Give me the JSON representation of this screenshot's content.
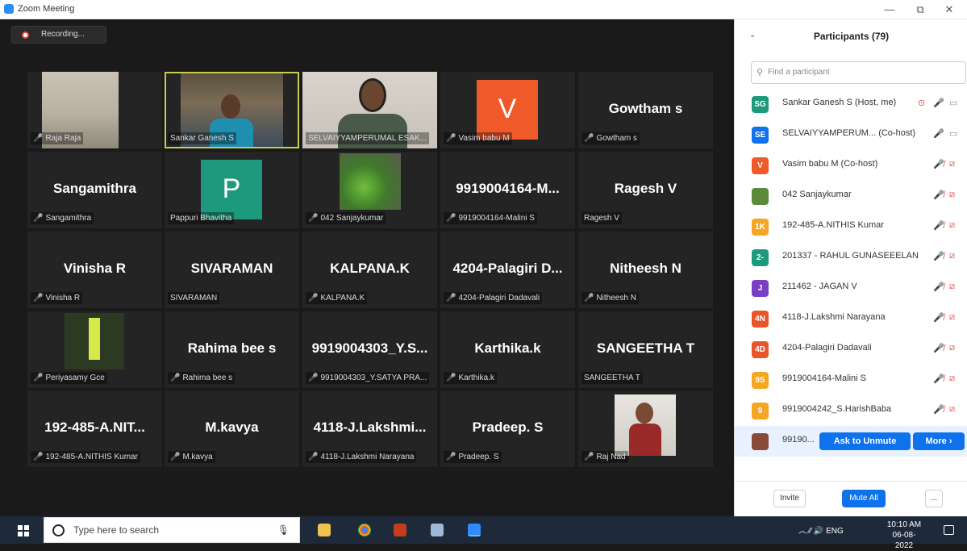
{
  "window": {
    "title": "Zoom Meeting",
    "minimize": "—",
    "restore": "⧉",
    "close": "✕"
  },
  "recording": {
    "label": "Recording..."
  },
  "tiles": [
    {
      "big": "",
      "label": "Raja Raja",
      "muted": true,
      "kind": "photo-room"
    },
    {
      "big": "",
      "label": "Sankar Ganesh S",
      "muted": false,
      "kind": "photo-person",
      "active": true
    },
    {
      "big": "",
      "label": "SELVAIYYAMPERUMAL ESAK...",
      "muted": false,
      "kind": "photo-person2"
    },
    {
      "big": "",
      "label": "Vasim babu M",
      "muted": true,
      "kind": "avatar",
      "avatar_letter": "V",
      "avatar_color": "#f0592a"
    },
    {
      "big": "Gowtham s",
      "label": "Gowtham s",
      "muted": true,
      "kind": "name"
    },
    {
      "big": "Sangamithra",
      "label": "Sangamithra",
      "muted": true,
      "kind": "name"
    },
    {
      "big": "",
      "label": "Pappuri Bhavitha",
      "muted": false,
      "kind": "avatar",
      "avatar_letter": "P",
      "avatar_color": "#1d9a7d"
    },
    {
      "big": "",
      "label": "042 Sanjaykumar",
      "muted": true,
      "kind": "photo-grass"
    },
    {
      "big": "9919004164-M...",
      "label": "9919004164-Malini S",
      "muted": true,
      "kind": "name"
    },
    {
      "big": "Ragesh V",
      "label": "Ragesh V",
      "muted": false,
      "kind": "name"
    },
    {
      "big": "Vinisha R",
      "label": "Vinisha R",
      "muted": true,
      "kind": "name"
    },
    {
      "big": "SIVARAMAN",
      "label": "SIVARAMAN",
      "muted": false,
      "kind": "name"
    },
    {
      "big": "KALPANA.K",
      "label": "KALPANA.K",
      "muted": true,
      "kind": "name"
    },
    {
      "big": "4204-Palagiri  D...",
      "label": "4204-Palagiri Dadavali",
      "muted": true,
      "kind": "name"
    },
    {
      "big": "Nitheesh N",
      "label": "Nitheesh N",
      "muted": true,
      "kind": "name"
    },
    {
      "big": "",
      "label": "Periyasamy Gce",
      "muted": true,
      "kind": "photo-board"
    },
    {
      "big": "Rahima bee s",
      "label": "Rahima bee s",
      "muted": true,
      "kind": "name"
    },
    {
      "big": "9919004303_Y.S...",
      "label": "9919004303_Y.SATYA PRA...",
      "muted": true,
      "kind": "name"
    },
    {
      "big": "Karthika.k",
      "label": "Karthika.k",
      "muted": true,
      "kind": "name"
    },
    {
      "big": "SANGEETHA  T",
      "label": "SANGEETHA  T",
      "muted": false,
      "kind": "name"
    },
    {
      "big": "192-485-A.NIT...",
      "label": "192-485-A.NITHIS Kumar",
      "muted": true,
      "kind": "name"
    },
    {
      "big": "M.kavya",
      "label": "M.kavya",
      "muted": true,
      "kind": "name"
    },
    {
      "big": "4118-J.Lakshmi...",
      "label": "4118-J.Lakshmi Narayana",
      "muted": true,
      "kind": "name"
    },
    {
      "big": "Pradeep. S",
      "label": "Pradeep. S",
      "muted": true,
      "kind": "name"
    },
    {
      "big": "",
      "label": "Raj Nad",
      "muted": true,
      "kind": "photo-kid"
    }
  ],
  "panel": {
    "title": "Participants (79)",
    "search_placeholder": "Find a participant",
    "participants": [
      {
        "initials": "SG",
        "color": "#1d9a7d",
        "name": "Sankar Ganesh S (Host, me)",
        "mic_muted": false,
        "video_off": false,
        "share": true
      },
      {
        "initials": "SE",
        "color": "#0e72ed",
        "name": "SELVAIYYAMPERUM...  (Co-host)",
        "mic_muted": false,
        "video_off": false,
        "share": false
      },
      {
        "initials": "V",
        "color": "#f0592a",
        "name": "Vasim babu M (Co-host)",
        "mic_muted": true,
        "video_off": true,
        "share": false
      },
      {
        "initials": "",
        "color": "#5a8a3a",
        "name": "042 Sanjaykumar",
        "mic_muted": true,
        "video_off": true,
        "share": false
      },
      {
        "initials": "1K",
        "color": "#f5a623",
        "name": "192-485-A.NITHIS Kumar",
        "mic_muted": true,
        "video_off": true,
        "share": false
      },
      {
        "initials": "2-",
        "color": "#1d9a7d",
        "name": "201337 - RAHUL GUNASEEELAN",
        "mic_muted": true,
        "video_off": true,
        "share": false
      },
      {
        "initials": "J",
        "color": "#7b3fc4",
        "name": "211462 - JAGAN V",
        "mic_muted": true,
        "video_off": true,
        "share": false
      },
      {
        "initials": "4N",
        "color": "#e8552b",
        "name": "4118-J.Lakshmi Narayana",
        "mic_muted": true,
        "video_off": true,
        "share": false
      },
      {
        "initials": "4D",
        "color": "#e8552b",
        "name": "4204-Palagiri Dadavali",
        "mic_muted": true,
        "video_off": true,
        "share": false
      },
      {
        "initials": "9S",
        "color": "#f5a623",
        "name": "9919004164-Malini S",
        "mic_muted": true,
        "video_off": true,
        "share": false
      },
      {
        "initials": "9",
        "color": "#f5a623",
        "name": "9919004242_S.HarishBaba",
        "mic_muted": true,
        "video_off": true,
        "share": false
      },
      {
        "initials": "",
        "color": "#8a4a3a",
        "name": "99190...",
        "mic_muted": true,
        "video_off": true,
        "share": false,
        "selected": true
      }
    ],
    "ask_unmute": "Ask to Unmute",
    "more": "More ›",
    "invite": "Invite",
    "mute_all": "Mute All",
    "overflow": "..."
  },
  "taskbar": {
    "search_placeholder": "Type here to search",
    "tray": "︿ ⁄⁄ 🔊 ENG",
    "time": "10:10 AM",
    "date": "06-08-2022"
  }
}
